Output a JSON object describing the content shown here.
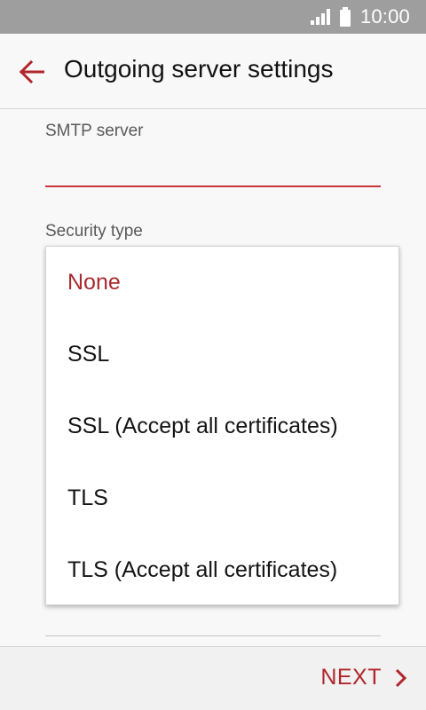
{
  "status_bar": {
    "time": "10:00",
    "icons": [
      "signal-icon",
      "battery-icon"
    ]
  },
  "app_bar": {
    "title": "Outgoing server settings",
    "back_icon": "arrow-left-icon"
  },
  "form": {
    "smtp_label": "SMTP server",
    "smtp_value": "",
    "security_label": "Security type"
  },
  "security_dropdown": {
    "selected": "None",
    "options": [
      {
        "label": "None",
        "selected": true
      },
      {
        "label": "SSL",
        "selected": false
      },
      {
        "label": "SSL (Accept all certificates)",
        "selected": false
      },
      {
        "label": "TLS",
        "selected": false
      },
      {
        "label": "TLS (Accept all certificates)",
        "selected": false
      }
    ]
  },
  "bottom_bar": {
    "next_label": "NEXT",
    "next_icon": "chevron-right-icon"
  },
  "colors": {
    "accent": "#b0262b",
    "status_bar": "#9e9e9e",
    "background": "#f8f8f8"
  }
}
